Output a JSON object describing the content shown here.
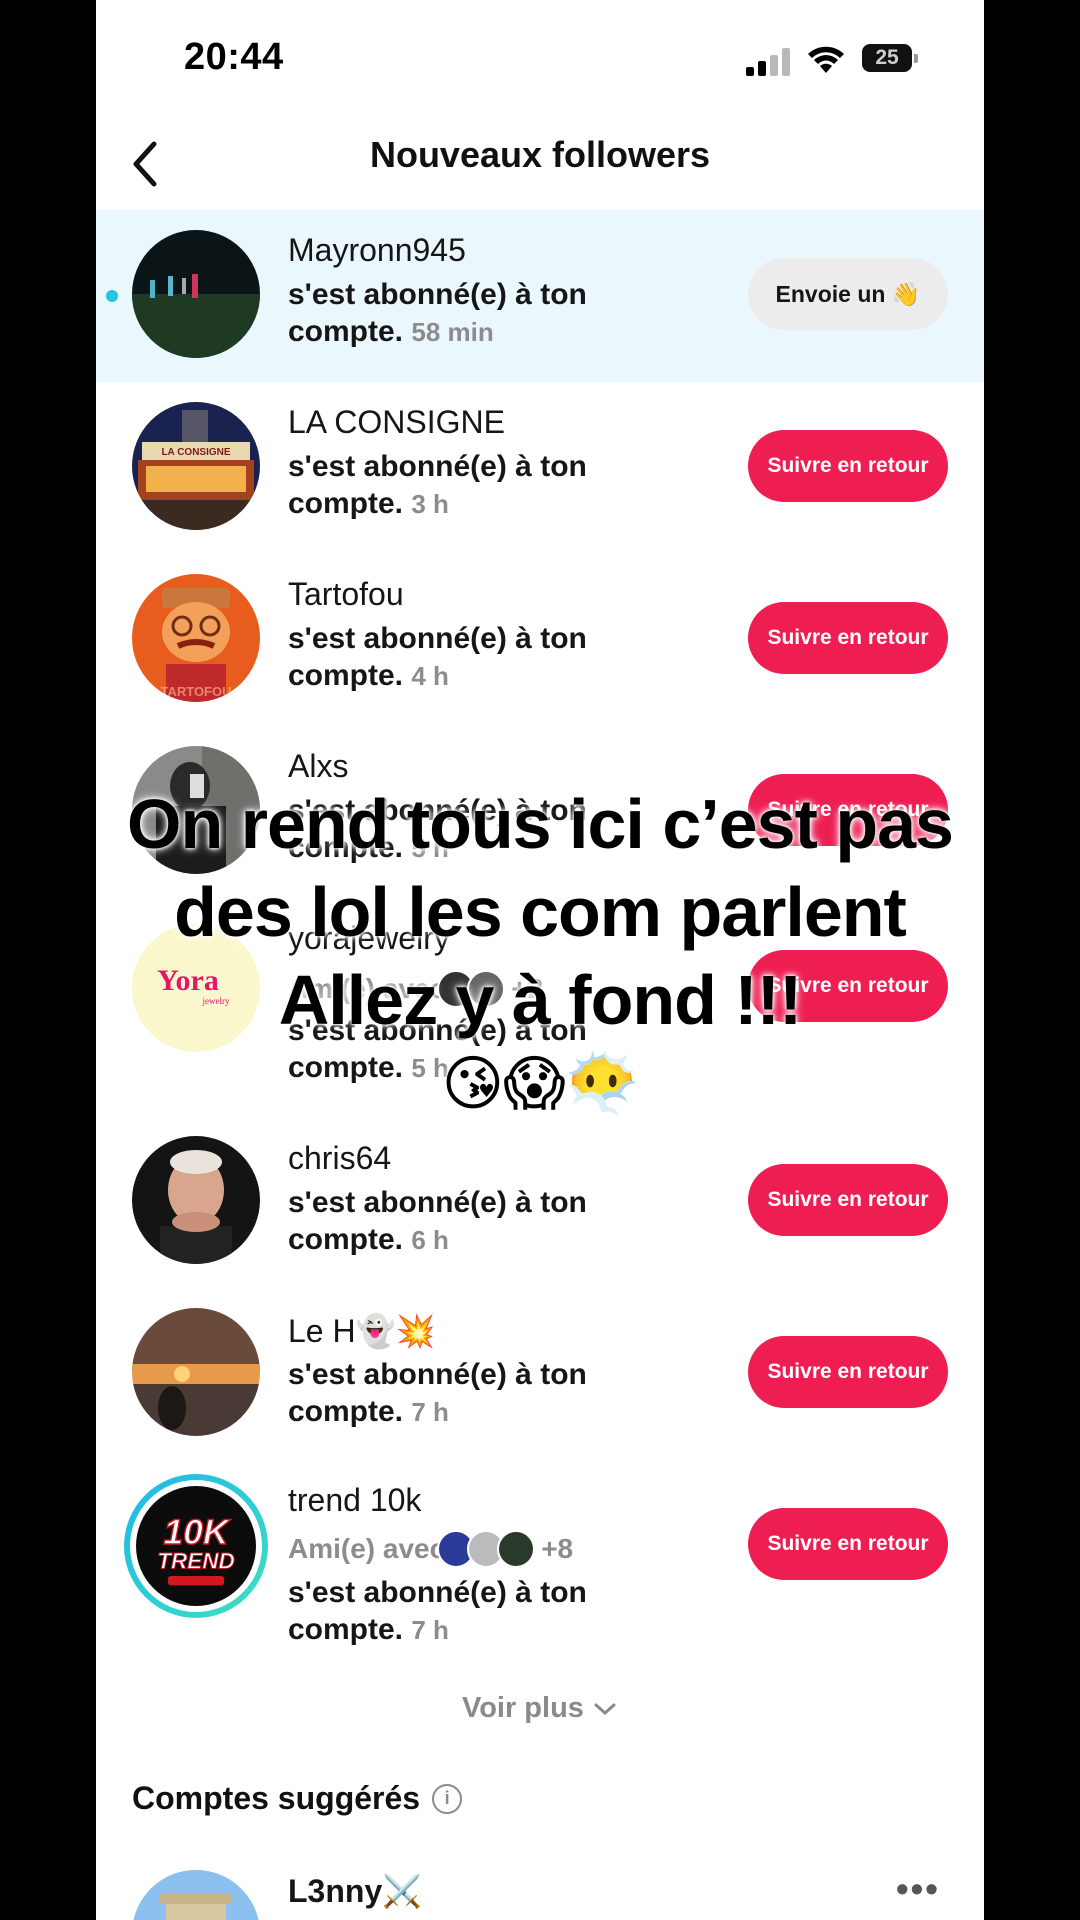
{
  "status_bar": {
    "time": "20:44",
    "battery": "25"
  },
  "header": {
    "title": "Nouveaux followers"
  },
  "rows": [
    {
      "name": "Mayronn945",
      "line1": "s'est abonné(e) à ton",
      "line2": "compte.",
      "time": "58 min",
      "button": "Envoie un 👋"
    },
    {
      "name": "LA CONSIGNE",
      "line1": "s'est abonné(e) à ton",
      "line2": "compte.",
      "time": "3 h",
      "button": "Suivre en retour"
    },
    {
      "name": "Tartofou",
      "line1": "s'est abonné(e) à ton",
      "line2": "compte.",
      "time": "4 h",
      "button": "Suivre en retour"
    },
    {
      "name": "Alxs",
      "line1": "s'est abonné(e) à ton",
      "line2": "compte.",
      "time": "5 h",
      "button": "Suivre en retour"
    },
    {
      "name": "yorajewelry",
      "friends": "Ami(e) avec",
      "friends_extra": "+2",
      "line1": "s'est abonné(e) à ton",
      "line2": "compte.",
      "time": "5 h",
      "button": "Suivre en retour"
    },
    {
      "name": "chris64",
      "line1": "s'est abonné(e) à ton",
      "line2": "compte.",
      "time": "6 h",
      "button": "Suivre en retour"
    },
    {
      "name": "Le H👻💥",
      "line1": "s'est abonné(e) à ton",
      "line2": "compte.",
      "time": "7 h",
      "button": "Suivre en retour"
    },
    {
      "name": "trend 10k",
      "friends": "Ami(e) avec",
      "friends_extra": "+8",
      "line1": "s'est abonné(e) à ton",
      "line2": "compte.",
      "time": "7 h",
      "button": "Suivre en retour"
    }
  ],
  "avatar_text": {
    "consigne": "LA CONSIGNE",
    "yora": "Yora",
    "yora_sub": "jewelry",
    "trend": "10K",
    "trend_sub": "TREND",
    "tartofou": "TARTOFOU"
  },
  "voir_plus": "Voir plus",
  "suggested": {
    "title": "Comptes suggérés",
    "name": "L3nny⚔️",
    "info_icon": "i"
  },
  "caption": {
    "line1": "On rend tous ici c’est pas",
    "line2": "des lol les com parlent",
    "line3": "Allez y à fond !!!",
    "emoji": "😘😱😶‍🌫️"
  },
  "colors": {
    "accent": "#ee1d52",
    "new_bg": "#eaf8fd",
    "dot": "#28c3e0"
  }
}
